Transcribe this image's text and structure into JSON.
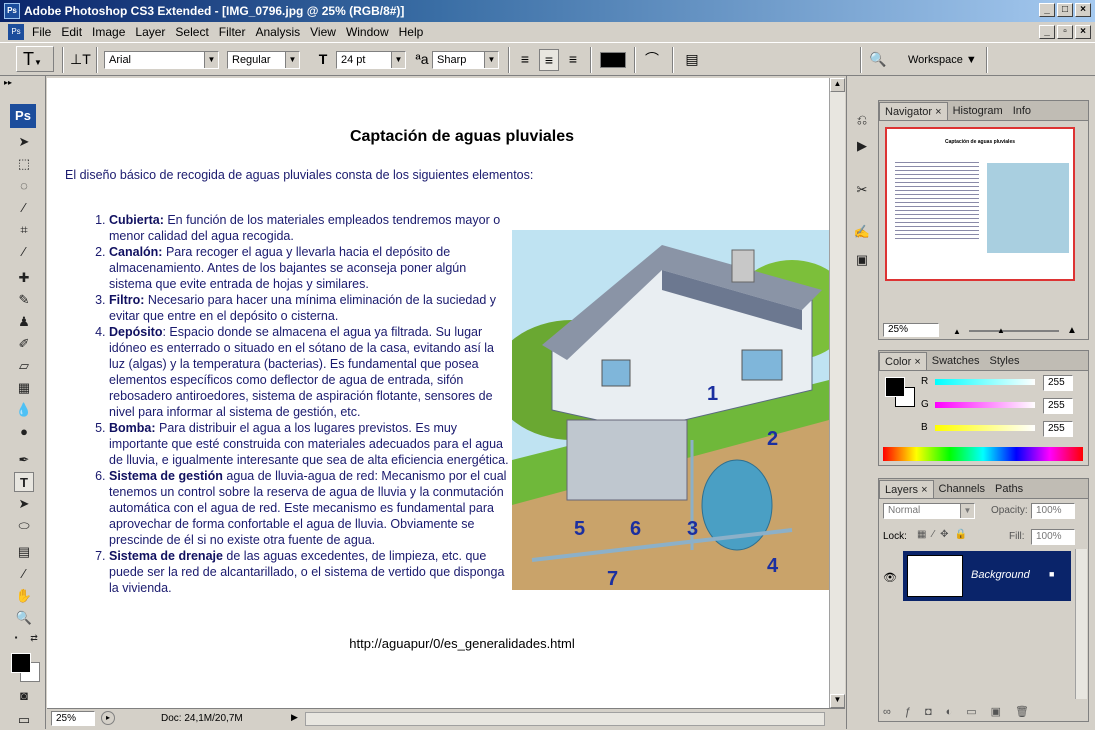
{
  "window": {
    "title": "Adobe Photoshop CS3 Extended - [IMG_0796.jpg @ 25% (RGB/8#)]",
    "app_icon": "Ps"
  },
  "menu": [
    "File",
    "Edit",
    "Image",
    "Layer",
    "Select",
    "Filter",
    "Analysis",
    "View",
    "Window",
    "Help"
  ],
  "options": {
    "font_family": "Arial",
    "font_style": "Regular",
    "font_size": "24 pt",
    "antialias": "Sharp",
    "workspace": "Workspace"
  },
  "toolbar": {
    "logo": "Ps"
  },
  "document": {
    "title": "Captación de aguas pluviales",
    "intro": "El diseño básico de recogida de aguas pluviales consta de los siguientes elementos:",
    "items": [
      {
        "term": "Cubierta:",
        "text": " En función de los materiales empleados tendremos mayor o menor calidad del agua recogida."
      },
      {
        "term": "Canalón:",
        "text": " Para recoger el agua y llevarla hacia el depósito de almacenamiento. Antes de los bajantes se aconseja poner algún sistema que evite entrada de hojas y similares."
      },
      {
        "term": "Filtro:",
        "text": " Necesario para hacer una mínima eliminación de la suciedad y evitar que entre en el depósito o cisterna."
      },
      {
        "term": "Depósito",
        "text": ": Espacio donde se almacena el agua ya filtrada. Su lugar idóneo es enterrado o situado en el sótano de la casa, evitando así la luz (algas) y la temperatura (bacterias). Es fundamental que posea elementos específicos como deflector de agua de entrada, sifón rebosadero antiroedores, sistema de aspiración flotante, sensores de nivel para informar al sistema de gestión, etc."
      },
      {
        "term": "Bomba:",
        "text": " Para distribuir el agua a los lugares previstos. Es muy importante que esté construida con materiales adecuados para el agua de lluvia, e igualmente interesante que sea de alta eficiencia energética."
      },
      {
        "term": "Sistema de gestión",
        "text": " agua de lluvia-agua de red: Mecanismo por el cual tenemos un control sobre la reserva de agua de lluvia y la conmutación automática con el agua de red. Este mecanismo es fundamental para aprovechar de forma confortable el agua de lluvia. Obviamente se prescinde de él si no existe otra fuente de agua."
      },
      {
        "term": "Sistema de drenaje",
        "text": " de las aguas excedentes, de limpieza, etc. que puede ser la red de alcantarillado, o el sistema de vertido que disponga la vivienda."
      }
    ],
    "diagram_labels": [
      "1",
      "2",
      "3",
      "4",
      "5",
      "6",
      "7"
    ],
    "url": "http://aguapur/0/es_generalidades.html"
  },
  "status": {
    "zoom": "25%",
    "doc": "Doc: 24,1M/20,7M"
  },
  "navigator": {
    "tabs": [
      "Navigator",
      "Histogram",
      "Info"
    ],
    "zoom": "25%"
  },
  "color": {
    "tabs": [
      "Color",
      "Swatches",
      "Styles"
    ],
    "channels": [
      {
        "label": "R",
        "value": "255"
      },
      {
        "label": "G",
        "value": "255"
      },
      {
        "label": "B",
        "value": "255"
      }
    ]
  },
  "layers": {
    "tabs": [
      "Layers",
      "Channels",
      "Paths"
    ],
    "blend": "Normal",
    "opacity_label": "Opacity:",
    "opacity": "100%",
    "lock_label": "Lock:",
    "fill_label": "Fill:",
    "fill": "100%",
    "layer_name": "Background"
  },
  "colors": {
    "titlebar": "#0a246a",
    "layer_selected": "#0a246a",
    "accent": "#1c4d9c"
  }
}
